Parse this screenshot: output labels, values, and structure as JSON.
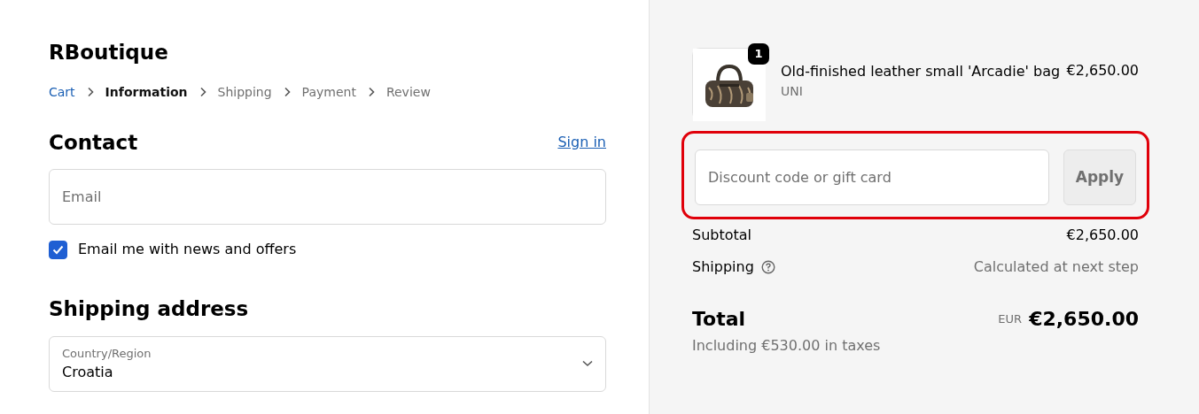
{
  "store_name": "RBoutique",
  "breadcrumb": [
    {
      "label": "Cart",
      "kind": "link"
    },
    {
      "label": "Information",
      "kind": "current"
    },
    {
      "label": "Shipping",
      "kind": "pending"
    },
    {
      "label": "Payment",
      "kind": "pending"
    },
    {
      "label": "Review",
      "kind": "pending"
    }
  ],
  "contact": {
    "title": "Contact",
    "sign_in": "Sign in",
    "email": {
      "placeholder": "Email"
    },
    "newsletter": {
      "label": "Email me with news and offers",
      "checked": true
    }
  },
  "shipping_address": {
    "title": "Shipping address",
    "country": {
      "label": "Country/Region",
      "value": "Croatia"
    }
  },
  "order": {
    "item": {
      "quantity": "1",
      "name": "Old-finished leather small 'Arcadie' bag",
      "variant": "UNI",
      "price": "€2,650.00"
    },
    "discount": {
      "placeholder": "Discount code or gift card",
      "button": "Apply",
      "highlighted": true
    },
    "subtotal": {
      "label": "Subtotal",
      "value": "€2,650.00"
    },
    "shipping": {
      "label": "Shipping",
      "value": "Calculated at next step"
    },
    "total": {
      "label": "Total",
      "currency": "EUR",
      "value": "€2,650.00",
      "taxes": "Including €530.00 in taxes"
    }
  }
}
